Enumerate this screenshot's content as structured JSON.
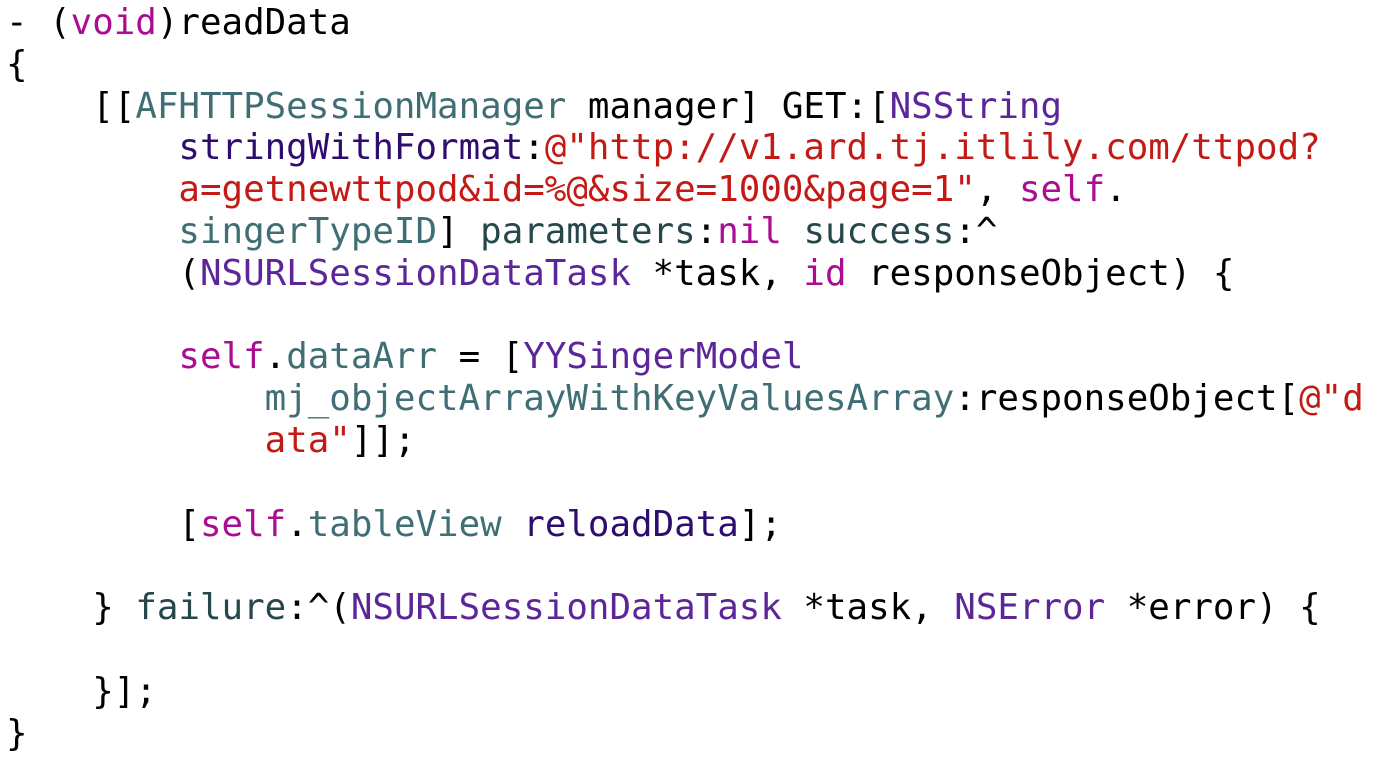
{
  "code": {
    "language": "objective-c",
    "colors": {
      "plain": "#000000",
      "kw": "#AA0D91",
      "cls": "#3F6E74",
      "type": "#5C2699",
      "method": "#2E0D6E",
      "param": "#26474B",
      "str": "#C41A16"
    },
    "lines": [
      [
        {
          "t": "- (",
          "c": "plain"
        },
        {
          "t": "void",
          "c": "kw"
        },
        {
          "t": ")readData",
          "c": "plain"
        }
      ],
      [
        {
          "t": "{",
          "c": "plain"
        }
      ],
      [
        {
          "t": "    [[",
          "c": "plain"
        },
        {
          "t": "AFHTTPSessionManager",
          "c": "cls"
        },
        {
          "t": " manager] GET:[",
          "c": "plain"
        },
        {
          "t": "NSString",
          "c": "type"
        }
      ],
      [
        {
          "t": "        ",
          "c": "plain"
        },
        {
          "t": "stringWithFormat",
          "c": "method"
        },
        {
          "t": ":",
          "c": "plain"
        },
        {
          "t": "@\"http://v1.ard.tj.itlily.com/ttpod?",
          "c": "str"
        }
      ],
      [
        {
          "t": "        ",
          "c": "plain"
        },
        {
          "t": "a=getnewttpod&id=%@&size=1000&page=1\"",
          "c": "str"
        },
        {
          "t": ", ",
          "c": "plain"
        },
        {
          "t": "self",
          "c": "kw"
        },
        {
          "t": ".",
          "c": "plain"
        }
      ],
      [
        {
          "t": "        ",
          "c": "plain"
        },
        {
          "t": "singerTypeID",
          "c": "cls"
        },
        {
          "t": "] ",
          "c": "plain"
        },
        {
          "t": "parameters",
          "c": "param"
        },
        {
          "t": ":",
          "c": "plain"
        },
        {
          "t": "nil",
          "c": "kw"
        },
        {
          "t": " ",
          "c": "plain"
        },
        {
          "t": "success",
          "c": "param"
        },
        {
          "t": ":^",
          "c": "plain"
        }
      ],
      [
        {
          "t": "        (",
          "c": "plain"
        },
        {
          "t": "NSURLSessionDataTask",
          "c": "type"
        },
        {
          "t": " *task, ",
          "c": "plain"
        },
        {
          "t": "id",
          "c": "kw"
        },
        {
          "t": " responseObject) {",
          "c": "plain"
        }
      ],
      [],
      [
        {
          "t": "        ",
          "c": "plain"
        },
        {
          "t": "self",
          "c": "kw"
        },
        {
          "t": ".",
          "c": "plain"
        },
        {
          "t": "dataArr",
          "c": "cls"
        },
        {
          "t": " = [",
          "c": "plain"
        },
        {
          "t": "YYSingerModel",
          "c": "type"
        }
      ],
      [
        {
          "t": "            ",
          "c": "plain"
        },
        {
          "t": "mj_objectArrayWithKeyValuesArray",
          "c": "cls"
        },
        {
          "t": ":responseObject[",
          "c": "plain"
        },
        {
          "t": "@\"d",
          "c": "str"
        }
      ],
      [
        {
          "t": "            ",
          "c": "plain"
        },
        {
          "t": "ata\"",
          "c": "str"
        },
        {
          "t": "]];",
          "c": "plain"
        }
      ],
      [],
      [
        {
          "t": "        [",
          "c": "plain"
        },
        {
          "t": "self",
          "c": "kw"
        },
        {
          "t": ".",
          "c": "plain"
        },
        {
          "t": "tableView",
          "c": "cls"
        },
        {
          "t": " ",
          "c": "plain"
        },
        {
          "t": "reloadData",
          "c": "method"
        },
        {
          "t": "];",
          "c": "plain"
        }
      ],
      [],
      [
        {
          "t": "    } ",
          "c": "plain"
        },
        {
          "t": "failure",
          "c": "param"
        },
        {
          "t": ":^(",
          "c": "plain"
        },
        {
          "t": "NSURLSessionDataTask",
          "c": "type"
        },
        {
          "t": " *task, ",
          "c": "plain"
        },
        {
          "t": "NSError",
          "c": "type"
        },
        {
          "t": " *error) {",
          "c": "plain"
        }
      ],
      [],
      [
        {
          "t": "    }];",
          "c": "plain"
        }
      ],
      [
        {
          "t": "}",
          "c": "plain"
        }
      ]
    ]
  }
}
